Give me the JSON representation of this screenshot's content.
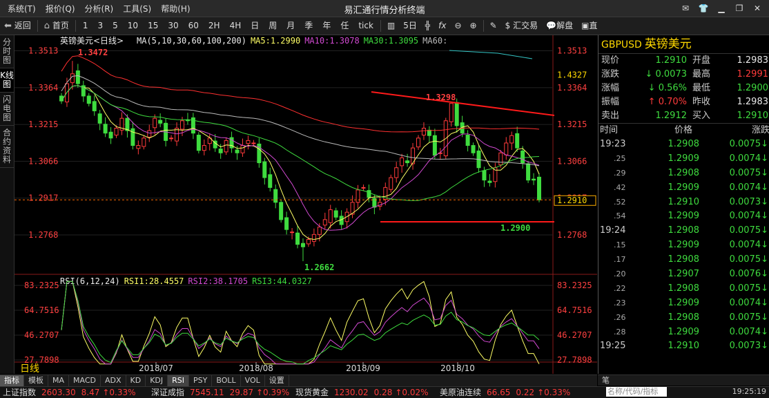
{
  "app": {
    "title": "易汇通行情分析终端",
    "menu": [
      "系统(T)",
      "报价(Q)",
      "分析(R)",
      "工具(S)",
      "帮助(H)"
    ]
  },
  "toolbar": {
    "back": "返回",
    "home": "首页",
    "periods": [
      "1",
      "3",
      "5",
      "10",
      "15",
      "30",
      "60",
      "2H",
      "4H",
      "日",
      "周",
      "月",
      "季",
      "年",
      "任",
      "tick"
    ],
    "five_day": "5日",
    "fx": "fx",
    "trade": "汇交易",
    "analysis": "解盘",
    "more": "直"
  },
  "side_tabs": [
    "分时图",
    "K线图",
    "闪电图",
    "合约资料"
  ],
  "chart": {
    "instrument_label": "英镑美元<日线>",
    "ma_label": "MA(5,10,30,60,100,200)",
    "ma_values": [
      "MA5:1.2990",
      "MA10:1.3078",
      "MA30:1.3095",
      "MA60:"
    ],
    "price_ticks": [
      "1.3513",
      "1.3364",
      "1.3215",
      "1.3066",
      "1.2917",
      "1.2768"
    ],
    "right_extra": [
      "1.4327"
    ],
    "last_price_box": "1.2910",
    "annotations": {
      "high": "1.3472",
      "low": "1.2662",
      "resistance": "1.3298",
      "recent_low": "1.2900"
    },
    "rsi_label": "RSI(6,12,24)",
    "rsi_values": [
      "RSI1:28.4557",
      "RSI2:38.1705",
      "RSI3:44.0327"
    ],
    "rsi_ticks": [
      "83.2325",
      "64.7516",
      "46.2707",
      "27.7898"
    ],
    "date_labels": [
      "2018/07",
      "2018/08",
      "2018/09",
      "2018/10"
    ],
    "period_badge": "日线",
    "colors": {
      "up": "#ff3b3b",
      "down": "#3fdc3f",
      "ma5": "#ffff66",
      "ma10": "#d24ad2",
      "ma30": "#3fdc3f",
      "ma60": "#bbbbbb",
      "ma100": "#ff3030",
      "ma200": "#34c6c6"
    }
  },
  "chart_data": {
    "type": "candlestick",
    "x_range": [
      "2018/06",
      "2018/10"
    ],
    "ylim": [
      1.262,
      1.352
    ],
    "rsi_ylim": [
      27.7898,
      83.2325
    ],
    "closes": [
      1.331,
      1.338,
      1.342,
      1.338,
      1.333,
      1.33,
      1.327,
      1.322,
      1.318,
      1.316,
      1.32,
      1.324,
      1.319,
      1.313,
      1.313,
      1.316,
      1.319,
      1.324,
      1.322,
      1.315,
      1.316,
      1.32,
      1.323,
      1.323,
      1.318,
      1.311,
      1.313,
      1.316,
      1.312,
      1.31,
      1.315,
      1.312,
      1.31,
      1.313,
      1.315,
      1.314,
      1.306,
      1.3,
      1.296,
      1.29,
      1.283,
      1.279,
      1.278,
      1.273,
      1.272,
      1.275,
      1.277,
      1.28,
      1.283,
      1.287,
      1.284,
      1.281,
      1.286,
      1.29,
      1.295,
      1.296,
      1.292,
      1.288,
      1.29,
      1.296,
      1.3,
      1.304,
      1.308,
      1.306,
      1.312,
      1.316,
      1.32,
      1.317,
      1.309,
      1.31,
      1.323,
      1.33,
      1.321,
      1.318,
      1.313,
      1.31,
      1.304,
      1.299,
      1.298,
      1.304,
      1.31,
      1.314,
      1.317,
      1.312,
      1.306,
      1.299,
      1.299,
      1.291
    ]
  },
  "quote": {
    "symbol": "GBPUSD",
    "name": "英镑美元",
    "rows": [
      {
        "l1": "现价",
        "v1": "1.2910",
        "c1": "grn",
        "l2": "开盘",
        "v2": "1.2983",
        "c2": "wht"
      },
      {
        "l1": "涨跌",
        "v1": "0.0073",
        "c1": "grn",
        "a1": "↓",
        "l2": "最高",
        "v2": "1.2991",
        "c2": "red"
      },
      {
        "l1": "涨幅",
        "v1": "0.56%",
        "c1": "grn",
        "a1": "↓",
        "l2": "最低",
        "v2": "1.2900",
        "c2": "grn"
      },
      {
        "l1": "振幅",
        "v1": "0.70%",
        "c1": "red",
        "a1": "↑",
        "l2": "昨收",
        "v2": "1.2983",
        "c2": "wht"
      },
      {
        "l1": "卖出",
        "v1": "1.2912",
        "c1": "grn",
        "l2": "买入",
        "v2": "1.2910",
        "c2": "grn"
      }
    ],
    "tick_header": {
      "time": "时间",
      "price": "价格",
      "change": "涨跌"
    },
    "ticks": [
      {
        "t": "19:23",
        "sub": false,
        "p": "1.2908",
        "c": "0.0075↓"
      },
      {
        "t": ".25",
        "sub": true,
        "p": "1.2909",
        "c": "0.0074↓"
      },
      {
        "t": ".29",
        "sub": true,
        "p": "1.2908",
        "c": "0.0075↓"
      },
      {
        "t": ".42",
        "sub": true,
        "p": "1.2909",
        "c": "0.0074↓"
      },
      {
        "t": ".52",
        "sub": true,
        "p": "1.2910",
        "c": "0.0073↓"
      },
      {
        "t": ".54",
        "sub": true,
        "p": "1.2909",
        "c": "0.0074↓"
      },
      {
        "t": "19:24",
        "sub": false,
        "p": "1.2908",
        "c": "0.0075↓"
      },
      {
        "t": ".15",
        "sub": true,
        "p": "1.2909",
        "c": "0.0074↓"
      },
      {
        "t": ".17",
        "sub": true,
        "p": "1.2908",
        "c": "0.0075↓"
      },
      {
        "t": ".20",
        "sub": true,
        "p": "1.2907",
        "c": "0.0076↓"
      },
      {
        "t": ".22",
        "sub": true,
        "p": "1.2908",
        "c": "0.0075↓"
      },
      {
        "t": ".23",
        "sub": true,
        "p": "1.2909",
        "c": "0.0074↓"
      },
      {
        "t": ".26",
        "sub": true,
        "p": "1.2908",
        "c": "0.0075↓"
      },
      {
        "t": ".28",
        "sub": true,
        "p": "1.2909",
        "c": "0.0074↓"
      },
      {
        "t": "19:25",
        "sub": false,
        "p": "1.2910",
        "c": "0.0073↓"
      }
    ]
  },
  "bottom_tabs": [
    "指标",
    "模板",
    "MA",
    "MACD",
    "ADX",
    "KD",
    "KDJ",
    "RSI",
    "PSY",
    "BOLL",
    "VOL",
    "设置"
  ],
  "bottom_right": "笔",
  "status": {
    "items": [
      {
        "name": "上证指数",
        "value": "2603.30",
        "chg": "8.47",
        "pct": "↑0.33%",
        "color": "red"
      },
      {
        "name": "深证成指",
        "value": "7545.11",
        "chg": "29.87",
        "pct": "↑0.39%",
        "color": "red"
      },
      {
        "name": "现货黄金",
        "value": "1230.02",
        "chg": "0.28",
        "pct": "↑0.02%",
        "color": "red"
      },
      {
        "name": "美原油连续",
        "value": "66.65",
        "chg": "0.22",
        "pct": "↑0.33%",
        "color": "red"
      }
    ],
    "search_placeholder": "名称/代码/指标",
    "clock": "19:25:19"
  }
}
